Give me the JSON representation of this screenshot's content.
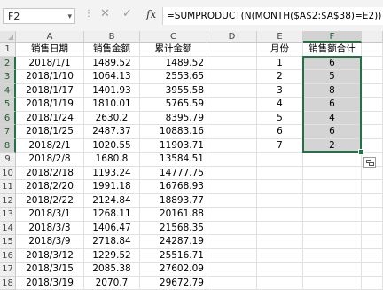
{
  "formula_bar": {
    "name_box": "F2",
    "cancel_icon": "✕",
    "enter_icon": "✓",
    "fx_label": "fx",
    "formula": "=SUMPRODUCT(N(MONTH($A$2:$A$38)=E2))"
  },
  "columns": [
    "A",
    "B",
    "C",
    "D",
    "E",
    "F"
  ],
  "rows": [
    "1",
    "2",
    "3",
    "4",
    "5",
    "6",
    "7",
    "8",
    "9",
    "10",
    "11",
    "12",
    "13",
    "14",
    "15",
    "16",
    "17",
    "18"
  ],
  "headers": {
    "A1": "销售日期",
    "B1": "销售金额",
    "C1": "累计金额",
    "E1": "月份",
    "F1": "销售额合计"
  },
  "data_rows": [
    {
      "a": "2018/1/1",
      "b": "1489.52",
      "c": "1489.52"
    },
    {
      "a": "2018/1/10",
      "b": "1064.13",
      "c": "2553.65"
    },
    {
      "a": "2018/1/17",
      "b": "1401.93",
      "c": "3955.58"
    },
    {
      "a": "2018/1/19",
      "b": "1810.01",
      "c": "5765.59"
    },
    {
      "a": "2018/1/24",
      "b": "2630.2",
      "c": "8395.79"
    },
    {
      "a": "2018/1/25",
      "b": "2487.37",
      "c": "10883.16"
    },
    {
      "a": "2018/2/1",
      "b": "1020.55",
      "c": "11903.71"
    },
    {
      "a": "2018/2/8",
      "b": "1680.8",
      "c": "13584.51"
    },
    {
      "a": "2018/2/18",
      "b": "1193.24",
      "c": "14777.75"
    },
    {
      "a": "2018/2/20",
      "b": "1991.18",
      "c": "16768.93"
    },
    {
      "a": "2018/2/22",
      "b": "2124.84",
      "c": "18893.77"
    },
    {
      "a": "2018/3/1",
      "b": "1268.11",
      "c": "20161.88"
    },
    {
      "a": "2018/3/3",
      "b": "1406.47",
      "c": "21568.35"
    },
    {
      "a": "2018/3/9",
      "b": "2718.84",
      "c": "24287.19"
    },
    {
      "a": "2018/3/12",
      "b": "1229.52",
      "c": "25516.71"
    },
    {
      "a": "2018/3/15",
      "b": "2085.38",
      "c": "27602.09"
    },
    {
      "a": "2018/3/19",
      "b": "2070.7",
      "c": "29672.79"
    }
  ],
  "summary": [
    {
      "month": "1",
      "total": "6"
    },
    {
      "month": "2",
      "total": "5"
    },
    {
      "month": "3",
      "total": "8"
    },
    {
      "month": "4",
      "total": "6"
    },
    {
      "month": "5",
      "total": "4"
    },
    {
      "month": "6",
      "total": "6"
    },
    {
      "month": "7",
      "total": "2"
    }
  ],
  "colors": {
    "accent": "#217346",
    "selection_fill": "#d4d4d4"
  },
  "icons": {
    "quick_analysis": "quick-analysis-icon"
  }
}
